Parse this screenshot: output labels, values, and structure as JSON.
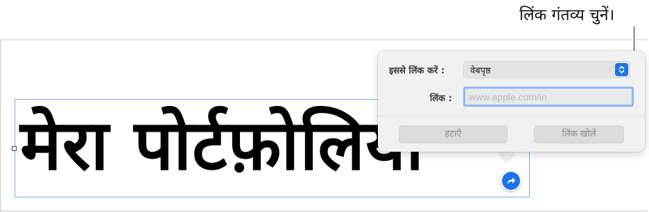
{
  "callout": {
    "text": "लिंक गंतव्य चुनें।"
  },
  "document": {
    "title_text": "मेरा पोर्टफ़ोलियो"
  },
  "link_popover": {
    "link_to_label": "इससे लिंक करें :",
    "link_to_value": "वेबपृष्ठ",
    "link_label": "लिंक :",
    "link_placeholder": "www.apple.com/in",
    "remove_button": "हटाएँ",
    "open_link_button": "लिंक खोलें"
  },
  "colors": {
    "accent": "#1d74e8",
    "selection_border": "#7aa7ef",
    "focus_ring": "#8fb6f2",
    "popover_bg": "#f1f1f1"
  },
  "icons": {
    "badge": "link-arrow-icon",
    "stepper": "chevron-updown-icon"
  }
}
